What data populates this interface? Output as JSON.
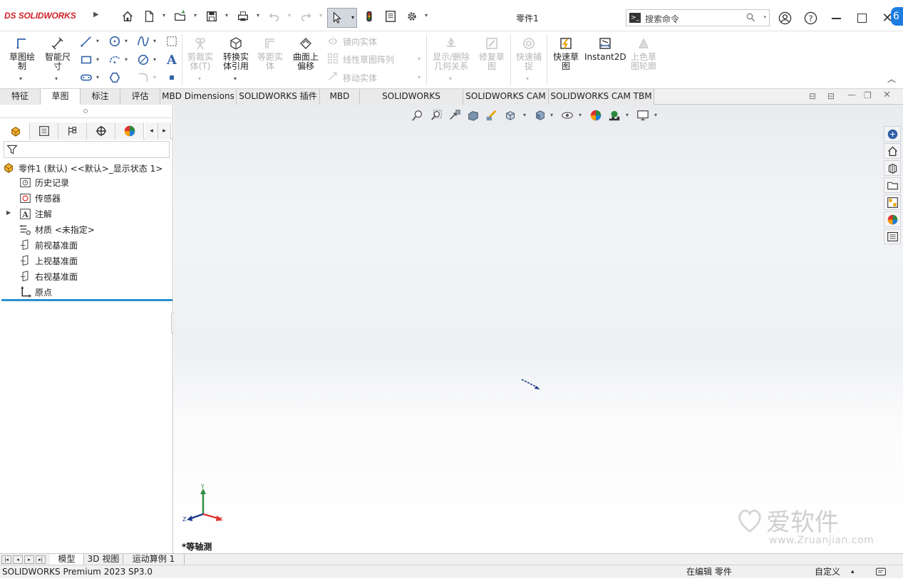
{
  "app": {
    "logo_ds": "DS",
    "logo_text": "SOLIDWORKS",
    "title": "零件1"
  },
  "search": {
    "placeholder": "搜索命令"
  },
  "ribbon": {
    "sketch": "草图绘制",
    "smart_dim": "智能尺寸",
    "trim": "剪裁实体(T)",
    "convert": "转换实体引用",
    "offset": "等距实体",
    "surface_offset": "曲面上偏移",
    "mirror": "镜向实体",
    "linear_pattern": "线性草图阵列",
    "move": "移动实体",
    "display_relations": "显示/删除几何关系",
    "repair": "修复草图",
    "quick_snap": "快速捕捉",
    "rapid_sketch": "快速草图",
    "instant2d": "Instant2D",
    "shaded_contours": "上色草图轮廓"
  },
  "tabs": [
    "特征",
    "草图",
    "标注",
    "评估",
    "MBD Dimensions",
    "SOLIDWORKS 插件",
    "MBD",
    "SOLIDWORKS Inspection",
    "SOLIDWORKS CAM",
    "SOLIDWORKS CAM TBM"
  ],
  "active_tab": "草图",
  "tree": {
    "root": "零件1 (默认) <<默认>_显示状态 1>",
    "items": [
      "历史记录",
      "传感器",
      "注解",
      "材质 <未指定>",
      "前视基准面",
      "上视基准面",
      "右视基准面",
      "原点"
    ]
  },
  "viewport": {
    "view_label": "*等轴测",
    "triad": {
      "y": "Y",
      "x": "X",
      "z": "Z"
    }
  },
  "bottom_tabs": [
    "模型",
    "3D 视图",
    "运动算例 1"
  ],
  "status": {
    "product": "SOLIDWORKS Premium 2023 SP3.0",
    "editing": "在编辑 零件",
    "custom": "自定义"
  },
  "watermark": {
    "text": "爱软件",
    "url": "www.Zruanjian.com"
  },
  "colors": {
    "accent_red": "#d2232a",
    "rollback_blue": "#2a8fd0",
    "icon_blue": "#3463a8"
  }
}
